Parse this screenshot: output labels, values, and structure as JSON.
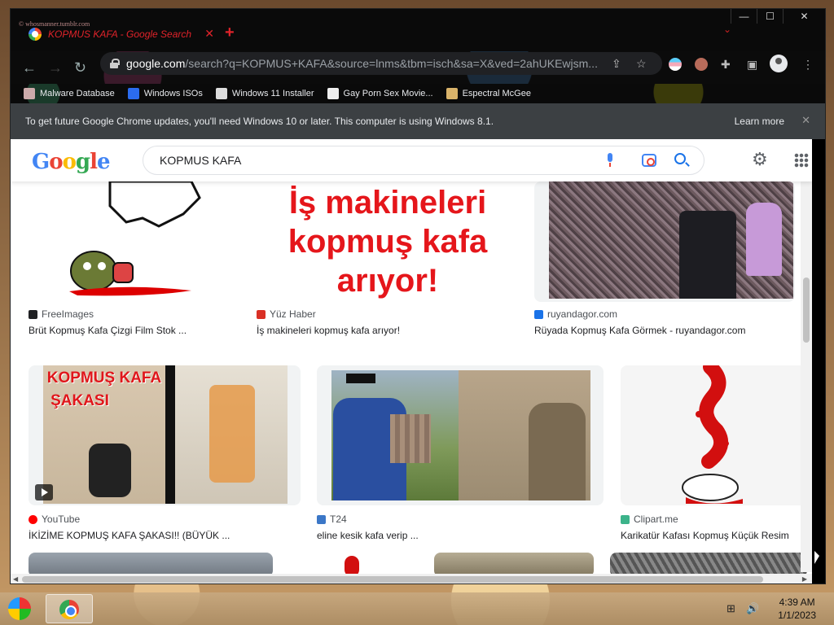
{
  "titlebar": {
    "profile_tag": "© whosmanner.tumblr.com",
    "tab_title": "KOPMUS KAFA - Google Search",
    "tab_close": "✕",
    "new_tab": "+",
    "controls": {
      "minimize": "—",
      "maximize": "☐",
      "close": "✕"
    }
  },
  "toolbar": {
    "url_domain": "google.com",
    "url_rest": "/search?q=KOPMUS+KAFA&source=lnms&tbm=isch&sa=X&ved=2ahUKEwjsm..."
  },
  "bookmarks": [
    {
      "label": "Malware Database",
      "color": "#caa"
    },
    {
      "label": "Windows ISOs",
      "color": "#2b6cf0"
    },
    {
      "label": "Windows 11 Installer",
      "color": "#ddd"
    },
    {
      "label": "Gay Porn Sex Movie...",
      "color": "#eee"
    },
    {
      "label": "Espectral McGee",
      "color": "#d9b36a"
    }
  ],
  "infobar": {
    "message": "To get future Google Chrome updates, you'll need Windows 10 or later. This computer is using Windows 8.1.",
    "learn_more": "Learn more"
  },
  "google": {
    "doodle_letters": [
      "G",
      "o",
      "o",
      "g",
      "l",
      "e"
    ],
    "search_query": "KOPMUS KAFA"
  },
  "results": [
    {
      "source": "FreeImages",
      "caption": "Brüt Kopmuş Kafa Çizgi Film Stok ...",
      "icon_color": "#202124"
    },
    {
      "source": "Yüz Haber",
      "caption": "İş makineleri kopmuş kafa arıyor!",
      "icon_color": "#d93025",
      "image_text": [
        "İş makineleri",
        "kopmuş kafa",
        "arıyor!"
      ]
    },
    {
      "source": "ruyandagor.com",
      "caption": "Rüyada Kopmuş Kafa Görmek - ruyandagor.com",
      "icon_color": "#1a73e8"
    },
    {
      "source": "YouTube",
      "caption": "İKİZİME KOPMUŞ KAFA ŞAKASI!! (BÜYÜK ...",
      "icon_color": "#ff0000",
      "image_text": [
        "KOPMUŞ KAFA",
        "ŞAKASI"
      ]
    },
    {
      "source": "T24",
      "caption": "eline kesik kafa verip ...",
      "icon_color": "#3b77c7"
    },
    {
      "source": "Clipart.me",
      "caption": "Karikatür Kafası Kopmuş Küçük Resim",
      "icon_color": "#3cb38a"
    }
  ],
  "taskbar": {
    "time": "4:39 AM",
    "date": "1/1/2023"
  }
}
